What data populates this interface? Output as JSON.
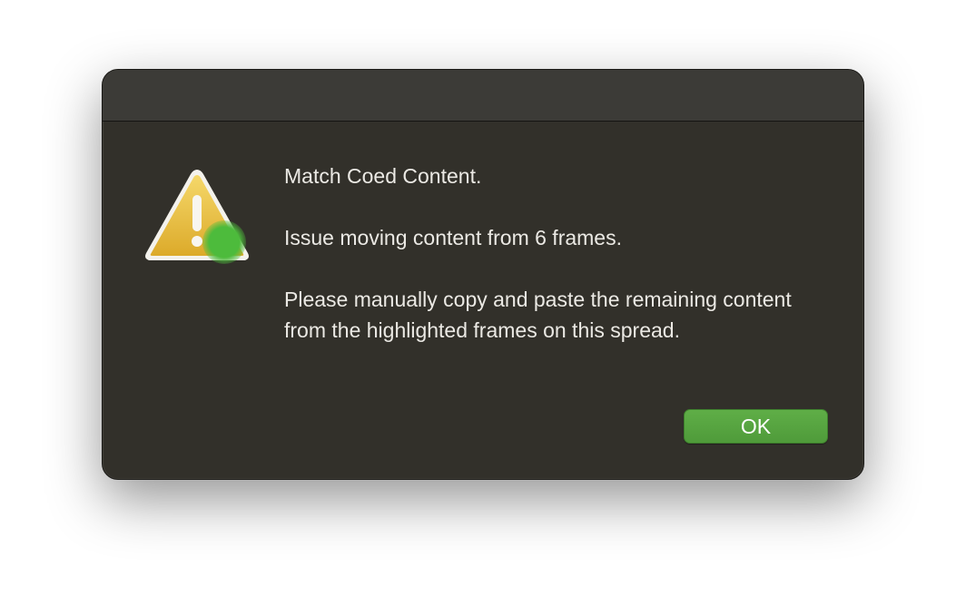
{
  "dialog": {
    "icon": "warning-triangle-icon",
    "badge_icon": "green-dot-icon",
    "message": {
      "title": "Match Coed Content.",
      "line2": "Issue moving content from 6 frames.",
      "line3": "Please manually copy and paste the remaining content from the highlighted frames on this spread."
    },
    "ok_label": "OK"
  },
  "colors": {
    "dialog_background": "#32302a",
    "titlebar_background": "#3c3b37",
    "text": "#ebe9e4",
    "button_green": "#55a340",
    "warning_yellow": "#e9c13c",
    "badge_green": "#4dbb3c"
  }
}
